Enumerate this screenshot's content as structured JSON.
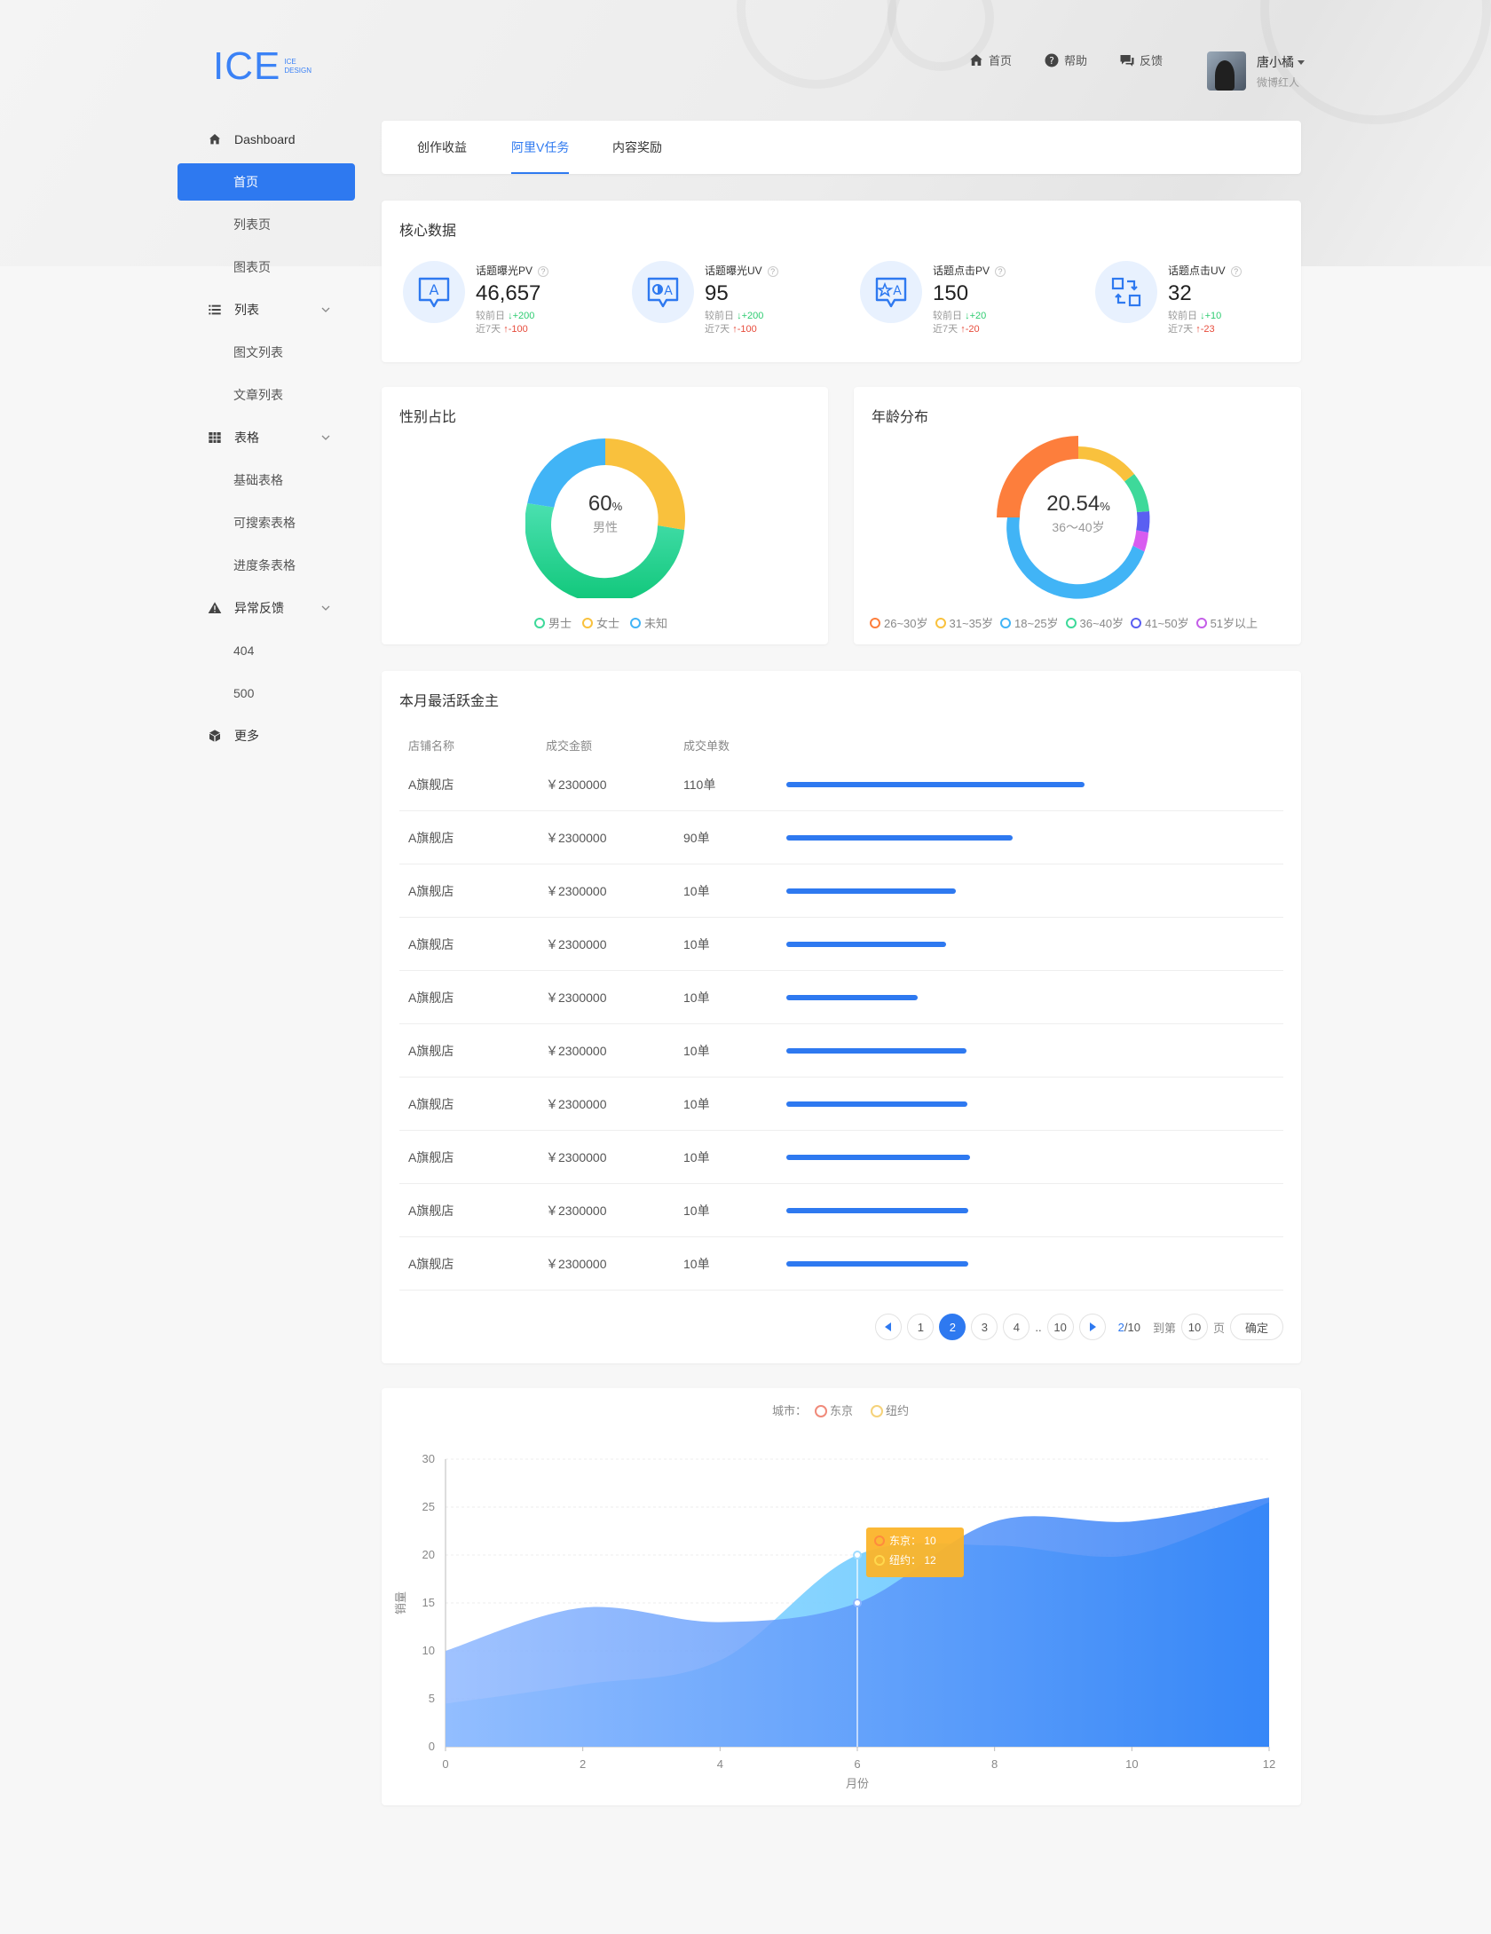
{
  "logo": {
    "main": "ICE",
    "sub1": "ICE",
    "sub2": "DESIGN"
  },
  "topnav": [
    {
      "label": "首页",
      "icon": "home-icon"
    },
    {
      "label": "帮助",
      "icon": "help-icon"
    },
    {
      "label": "反馈",
      "icon": "chat-icon"
    }
  ],
  "user": {
    "name": "唐小橘",
    "title": "微博红人"
  },
  "sidebar": {
    "dashboard": "Dashboard",
    "home": "首页",
    "listpage": "列表页",
    "chartpage": "图表页",
    "list": "列表",
    "imgtext_list": "图文列表",
    "article_list": "文章列表",
    "table": "表格",
    "basic_table": "基础表格",
    "search_table": "可搜索表格",
    "progress_table": "进度条表格",
    "exception": "异常反馈",
    "e404": "404",
    "e500": "500",
    "more": "更多"
  },
  "tabs": [
    "创作收益",
    "阿里V任务",
    "内容奖励"
  ],
  "core": {
    "title": "核心数据",
    "stats": [
      {
        "label": "话题曝光PV",
        "value": "46,657",
        "day_label": "较前日",
        "day_delta": "+200",
        "week_label": "近7天",
        "week_delta": "-100"
      },
      {
        "label": "话题曝光UV",
        "value": "95",
        "day_label": "较前日",
        "day_delta": "+200",
        "week_label": "近7天",
        "week_delta": "-100"
      },
      {
        "label": "话题点击PV",
        "value": "150",
        "day_label": "较前日",
        "day_delta": "+20",
        "week_label": "近7天",
        "week_delta": "-20"
      },
      {
        "label": "话题点击UV",
        "value": "32",
        "day_label": "较前日",
        "day_delta": "+10",
        "week_label": "近7天",
        "week_delta": "-23"
      }
    ]
  },
  "gender": {
    "title": "性别占比",
    "center_value": "60",
    "center_unit": "%",
    "center_label": "男性",
    "legend": [
      "男士",
      "女士",
      "未知"
    ]
  },
  "age": {
    "title": "年龄分布",
    "center_value": "20.54",
    "center_unit": "%",
    "center_label": "36～40岁",
    "legend": [
      "26~30岁",
      "31~35岁",
      "18~25岁",
      "36~40岁",
      "41~50岁",
      "51岁以上"
    ]
  },
  "colors": {
    "accent": "#2e79f0",
    "gender": [
      "#23d08a",
      "#f9c13d",
      "#41b4f6"
    ],
    "age": [
      "#fd7e3c",
      "#f9c13d",
      "#41b4f6",
      "#3ed99a",
      "#5a5ff2",
      "#c45ee8"
    ]
  },
  "ranking": {
    "title": "本月最活跃金主",
    "headers": [
      "店铺名称",
      "成交金额",
      "成交单数"
    ],
    "rows": [
      {
        "shop": "A旗舰店",
        "amount": "￥2300000",
        "orders": "110单",
        "progress": 0.58
      },
      {
        "shop": "A旗舰店",
        "amount": "￥2300000",
        "orders": "90单",
        "progress": 0.44
      },
      {
        "shop": "A旗舰店",
        "amount": "￥2300000",
        "orders": "10单",
        "progress": 0.33
      },
      {
        "shop": "A旗舰店",
        "amount": "￥2300000",
        "orders": "10单",
        "progress": 0.31
      },
      {
        "shop": "A旗舰店",
        "amount": "￥2300000",
        "orders": "10单",
        "progress": 0.255
      },
      {
        "shop": "A旗舰店",
        "amount": "￥2300000",
        "orders": "10单",
        "progress": 0.35
      },
      {
        "shop": "A旗舰店",
        "amount": "￥2300000",
        "orders": "10单",
        "progress": 0.352
      },
      {
        "shop": "A旗舰店",
        "amount": "￥2300000",
        "orders": "10单",
        "progress": 0.357
      },
      {
        "shop": "A旗舰店",
        "amount": "￥2300000",
        "orders": "10单",
        "progress": 0.353
      },
      {
        "shop": "A旗舰店",
        "amount": "￥2300000",
        "orders": "10单",
        "progress": 0.353
      }
    ],
    "pager": {
      "pages": [
        "1",
        "2",
        "3",
        "4"
      ],
      "ellipsis": "..",
      "last": "10",
      "current_page": "2",
      "total_pages": "/10",
      "goto_label": "到第",
      "goto_value": "10",
      "page_unit": "页",
      "confirm": "确定"
    }
  },
  "chart_data": {
    "type": "area",
    "legend_title": "城市：",
    "xlabel": "月份",
    "ylabel": "销量",
    "xlim": [
      0,
      12
    ],
    "ylim": [
      0,
      30
    ],
    "x_ticks": [
      0,
      2,
      4,
      6,
      8,
      10,
      12
    ],
    "y_ticks": [
      0,
      5,
      10,
      15,
      20,
      25,
      30
    ],
    "series": [
      {
        "name": "东京",
        "color": "#8ab4ff",
        "x": [
          0,
          2,
          4,
          6,
          8,
          10,
          12
        ],
        "y": [
          10,
          14.5,
          13,
          15,
          23.5,
          23.5,
          26
        ]
      },
      {
        "name": "纽约",
        "color": "#a7dcff",
        "x": [
          0,
          2,
          4,
          6,
          8,
          10,
          12
        ],
        "y": [
          4.5,
          6.5,
          9,
          20,
          21,
          20,
          25.5
        ]
      }
    ],
    "tooltip": {
      "x": 6,
      "lines": [
        {
          "name": "东京",
          "value": "10"
        },
        {
          "name": "纽约",
          "value": "12"
        }
      ]
    }
  }
}
